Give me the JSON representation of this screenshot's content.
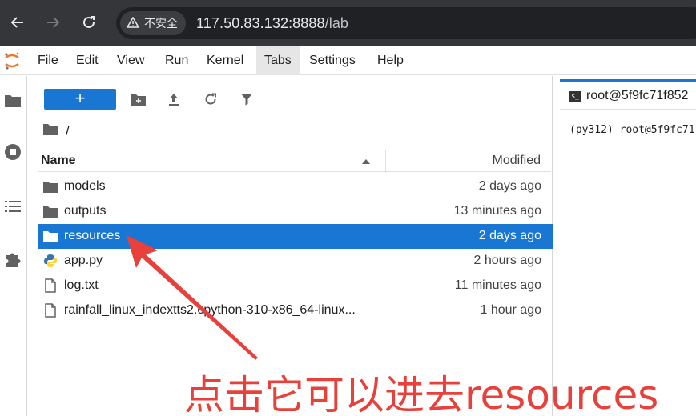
{
  "browser": {
    "security_label": "不安全",
    "url_host": "117.50.83.132:8888",
    "url_path": "/lab"
  },
  "menu": [
    "File",
    "Edit",
    "View",
    "Run",
    "Kernel",
    "Tabs",
    "Settings",
    "Help"
  ],
  "menu_active": "Tabs",
  "toolbar": {
    "new_label": "+"
  },
  "breadcrumb": {
    "path": "/"
  },
  "file_list": {
    "name_header": "Name",
    "modified_header": "Modified",
    "rows": [
      {
        "name": "models",
        "modified": "2 days ago",
        "type": "folder"
      },
      {
        "name": "outputs",
        "modified": "13 minutes ago",
        "type": "folder"
      },
      {
        "name": "resources",
        "modified": "2 days ago",
        "type": "folder",
        "selected": true
      },
      {
        "name": "app.py",
        "modified": "2 hours ago",
        "type": "python"
      },
      {
        "name": "log.txt",
        "modified": "11 minutes ago",
        "type": "file"
      },
      {
        "name": "rainfall_linux_indextts2.cpython-310-x86_64-linux...",
        "modified": "1 hour ago",
        "type": "file"
      }
    ]
  },
  "terminal": {
    "tab_label": "root@5f9fc71f852",
    "line": "(py312) root@5f9fc71"
  },
  "annotation": {
    "text": "点击它可以进去resources",
    "color": "#e8413b"
  },
  "colors": {
    "accent": "#1976d2",
    "chrome": "#35363a"
  }
}
